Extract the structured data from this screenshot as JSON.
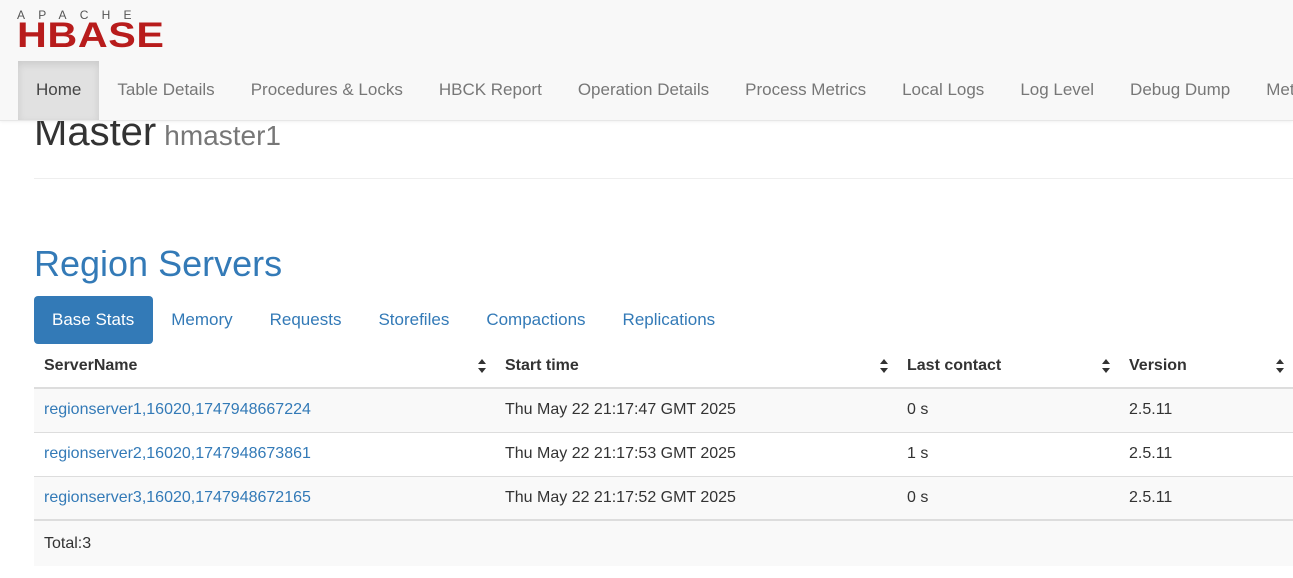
{
  "logo": {
    "apache": "APACHE",
    "hbase": "HBASE"
  },
  "nav": {
    "items": [
      {
        "label": "Home",
        "active": true
      },
      {
        "label": "Table Details"
      },
      {
        "label": "Procedures & Locks"
      },
      {
        "label": "HBCK Report"
      },
      {
        "label": "Operation Details"
      },
      {
        "label": "Process Metrics"
      },
      {
        "label": "Local Logs"
      },
      {
        "label": "Log Level"
      },
      {
        "label": "Debug Dump"
      },
      {
        "label": "Metri"
      }
    ]
  },
  "header": {
    "title": "Master",
    "host": "hmaster1"
  },
  "region_servers": {
    "title": "Region Servers",
    "tabs": [
      {
        "label": "Base Stats",
        "active": true
      },
      {
        "label": "Memory"
      },
      {
        "label": "Requests"
      },
      {
        "label": "Storefiles"
      },
      {
        "label": "Compactions"
      },
      {
        "label": "Replications"
      }
    ],
    "columns": [
      "ServerName",
      "Start time",
      "Last contact",
      "Version"
    ],
    "rows": [
      {
        "server": "regionserver1,16020,1747948667224",
        "start": "Thu May 22 21:17:47 GMT 2025",
        "contact": "0 s",
        "version": "2.5.11"
      },
      {
        "server": "regionserver2,16020,1747948673861",
        "start": "Thu May 22 21:17:53 GMT 2025",
        "contact": "1 s",
        "version": "2.5.11"
      },
      {
        "server": "regionserver3,16020,1747948672165",
        "start": "Thu May 22 21:17:52 GMT 2025",
        "contact": "0 s",
        "version": "2.5.11"
      }
    ],
    "total": "Total:3"
  },
  "colors": {
    "brand_red": "#b81c1c",
    "link_blue": "#337ab7",
    "nav_bg": "#f8f8f8",
    "nav_active_bg": "#e1e1e1"
  },
  "icons": {
    "sort": "sort-both-icon"
  }
}
